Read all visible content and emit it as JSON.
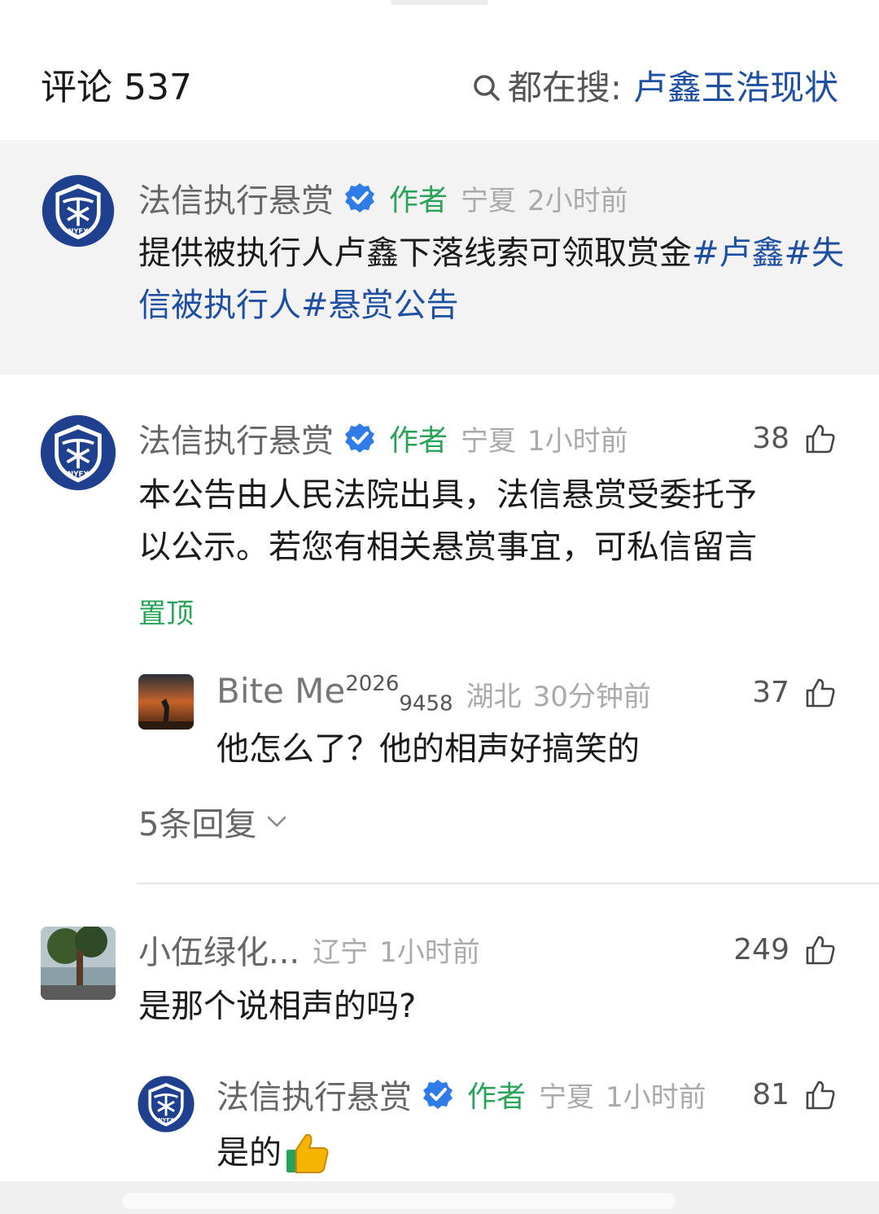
{
  "header": {
    "title": "评论 537",
    "search_prefix": "都在搜:",
    "search_query": "卢鑫玉浩现状"
  },
  "pinned_post": {
    "author": "法信执行悬赏",
    "author_tag": "作者",
    "location": "宁夏",
    "time": "2小时前",
    "text_plain": "提供被执行人卢鑫下落线索可领取赏金",
    "tag1": "#卢鑫",
    "tag2": "#失信被执行人",
    "tag3": "#悬赏公告"
  },
  "comments": [
    {
      "author": "法信执行悬赏",
      "author_tag": "作者",
      "location": "宁夏",
      "time": "1小时前",
      "likes": "38",
      "line1": "本公告由人民法院出具，法信悬赏受委托予",
      "line2": "以公示。若您有相关悬赏事宜，可私信留言",
      "pin_label": "置顶",
      "reply": {
        "author": "Bite Me",
        "author_sup": "2026",
        "author_sub": "9458",
        "location": "湖北",
        "time": "30分钟前",
        "likes": "37",
        "text": "他怎么了？他的相声好搞笑的"
      },
      "more_replies": "5条回复"
    },
    {
      "author": "小伍绿化...",
      "location": "辽宁",
      "time": "1小时前",
      "likes": "249",
      "text": "是那个说相声的吗?",
      "reply": {
        "author": "法信执行悬赏",
        "author_tag": "作者",
        "location": "宁夏",
        "time": "1小时前",
        "likes": "81",
        "text": "是的"
      }
    }
  ],
  "icons": {
    "search": "search-icon",
    "verified": "verified-badge-icon",
    "like": "thumbs-up-icon",
    "expand": "chevron-down-icon",
    "emoji": "thumbs-up-emoji"
  },
  "colors": {
    "link_blue": "#1e4fa0",
    "author_green": "#2aa35a",
    "verified_blue": "#2f7be8",
    "logo_navy": "#1f3f8f"
  }
}
